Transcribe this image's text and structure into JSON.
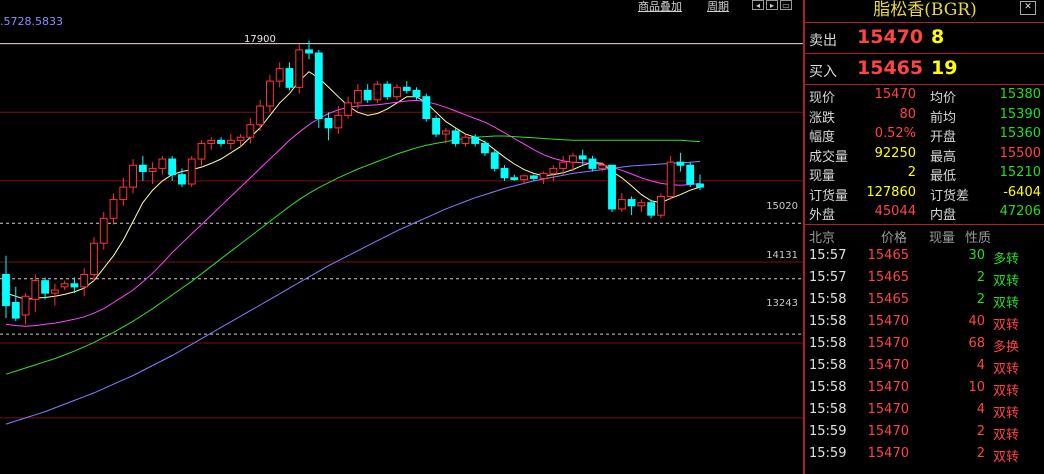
{
  "toolbar": {
    "link1": "商品叠加",
    "link2": "周期",
    "icons": [
      "prev-icon",
      "next-icon",
      "window-icon"
    ]
  },
  "chart": {
    "ma_readout": ".5728.5833",
    "high_marker": "17900",
    "price_levels": [
      {
        "label": "15020",
        "value": 15020
      },
      {
        "label": "14131",
        "value": 14131
      },
      {
        "label": "13243",
        "value": 13243
      }
    ]
  },
  "chart_data": {
    "type": "candlestick",
    "y_range": [
      11000,
      18600
    ],
    "grid_levels": [
      17900,
      16800,
      15700,
      14400,
      13100,
      11900
    ],
    "candles": [
      [
        14200,
        14500,
        13500,
        13700
      ],
      [
        13750,
        14000,
        13450,
        13500
      ],
      [
        13550,
        13900,
        13400,
        13850
      ],
      [
        13800,
        14200,
        13600,
        14100
      ],
      [
        14100,
        14150,
        13800,
        13900
      ],
      [
        13900,
        14050,
        13700,
        13950
      ],
      [
        14000,
        14100,
        13950,
        14050
      ],
      [
        14050,
        14150,
        13900,
        14000
      ],
      [
        14000,
        14300,
        13850,
        14200
      ],
      [
        14200,
        14800,
        14100,
        14700
      ],
      [
        14700,
        15200,
        14600,
        15100
      ],
      [
        15100,
        15500,
        15000,
        15400
      ],
      [
        15400,
        15750,
        15300,
        15600
      ],
      [
        15600,
        16050,
        15500,
        15950
      ],
      [
        15950,
        16100,
        15700,
        15850
      ],
      [
        15850,
        16000,
        15650,
        15900
      ],
      [
        15900,
        16100,
        15800,
        16050
      ],
      [
        16050,
        16100,
        15700,
        15800
      ],
      [
        15800,
        15900,
        15600,
        15650
      ],
      [
        15650,
        16100,
        15600,
        16050
      ],
      [
        16050,
        16350,
        15950,
        16300
      ],
      [
        16300,
        16400,
        16200,
        16350
      ],
      [
        16350,
        16400,
        16250,
        16300
      ],
      [
        16300,
        16450,
        16200,
        16350
      ],
      [
        16350,
        16450,
        16250,
        16400
      ],
      [
        16400,
        16700,
        16300,
        16600
      ],
      [
        16600,
        17000,
        16500,
        16900
      ],
      [
        16900,
        17400,
        16800,
        17300
      ],
      [
        17300,
        17600,
        17200,
        17500
      ],
      [
        17500,
        17600,
        17150,
        17200
      ],
      [
        17200,
        17900,
        17100,
        17800
      ],
      [
        17800,
        17950,
        17650,
        17750
      ],
      [
        17750,
        17800,
        16550,
        16700
      ],
      [
        16700,
        16800,
        16350,
        16550
      ],
      [
        16550,
        16900,
        16450,
        16750
      ],
      [
        16750,
        17050,
        16700,
        16950
      ],
      [
        16950,
        17250,
        16850,
        17150
      ],
      [
        17150,
        17250,
        16950,
        17000
      ],
      [
        17000,
        17300,
        16950,
        17250
      ],
      [
        17250,
        17300,
        17000,
        17050
      ],
      [
        17050,
        17250,
        17000,
        17200
      ],
      [
        17200,
        17300,
        17100,
        17150
      ],
      [
        17150,
        17200,
        17000,
        17050
      ],
      [
        17050,
        17100,
        16650,
        16700
      ],
      [
        16700,
        16750,
        16400,
        16450
      ],
      [
        16450,
        16550,
        16300,
        16500
      ],
      [
        16500,
        16550,
        16250,
        16300
      ],
      [
        16300,
        16450,
        16250,
        16400
      ],
      [
        16400,
        16450,
        16250,
        16300
      ],
      [
        16300,
        16350,
        16100,
        16150
      ],
      [
        16150,
        16200,
        15850,
        15900
      ],
      [
        15900,
        15950,
        15700,
        15750
      ],
      [
        15750,
        15800,
        15700,
        15720
      ],
      [
        15720,
        15800,
        15650,
        15780
      ],
      [
        15780,
        15800,
        15700,
        15740
      ],
      [
        15740,
        15850,
        15650,
        15820
      ],
      [
        15820,
        15950,
        15700,
        15900
      ],
      [
        15900,
        16100,
        15800,
        16000
      ],
      [
        16000,
        16150,
        15850,
        16100
      ],
      [
        16100,
        16200,
        15950,
        16050
      ],
      [
        16050,
        16100,
        15850,
        15900
      ],
      [
        15900,
        16000,
        15850,
        15950
      ],
      [
        15950,
        15900,
        15200,
        15250
      ],
      [
        15250,
        15500,
        15200,
        15400
      ],
      [
        15400,
        15450,
        15150,
        15300
      ],
      [
        15300,
        15400,
        15200,
        15350
      ],
      [
        15350,
        15400,
        15100,
        15150
      ],
      [
        15150,
        15500,
        15100,
        15450
      ],
      [
        15450,
        16100,
        15400,
        16000
      ],
      [
        16000,
        16150,
        15850,
        15950
      ],
      [
        15950,
        16000,
        15600,
        15650
      ],
      [
        15650,
        15800,
        15550,
        15600
      ]
    ],
    "ma_lines": [
      {
        "name": "ma5",
        "color": "#ffffaa",
        "values": [
          13900,
          13850,
          13800,
          13820,
          13830,
          13850,
          13880,
          13920,
          13980,
          14100,
          14300,
          14500,
          14750,
          15050,
          15350,
          15550,
          15700,
          15800,
          15850,
          15880,
          15920,
          15980,
          16050,
          16150,
          16250,
          16400,
          16550,
          16750,
          16950,
          17100,
          17300,
          17450,
          17350,
          17200,
          17050,
          16900,
          16800,
          16750,
          16780,
          16850,
          16950,
          17050,
          17050,
          16950,
          16800,
          16650,
          16550,
          16450,
          16400,
          16320,
          16200,
          16080,
          15970,
          15880,
          15820,
          15780,
          15800,
          15830,
          15880,
          15950,
          16000,
          15980,
          15850,
          15750,
          15620,
          15480,
          15380,
          15350,
          15420,
          15480,
          15550,
          15600
        ]
      },
      {
        "name": "ma10",
        "color": "#ff44ff",
        "values": [
          13400,
          13380,
          13370,
          13380,
          13400,
          13420,
          13450,
          13480,
          13520,
          13580,
          13650,
          13750,
          13850,
          13950,
          14080,
          14220,
          14380,
          14550,
          14700,
          14850,
          15000,
          15150,
          15300,
          15450,
          15600,
          15750,
          15900,
          16050,
          16200,
          16350,
          16480,
          16600,
          16700,
          16780,
          16840,
          16880,
          16900,
          16910,
          16920,
          16940,
          16960,
          16980,
          16990,
          16970,
          16930,
          16880,
          16820,
          16760,
          16700,
          16640,
          16560,
          16470,
          16380,
          16290,
          16200,
          16120,
          16060,
          16020,
          16000,
          15990,
          15980,
          15960,
          15920,
          15870,
          15810,
          15750,
          15700,
          15660,
          15640,
          15630,
          15640,
          15660
        ]
      },
      {
        "name": "ma20",
        "color": "#33dd33",
        "values": [
          12600,
          12650,
          12700,
          12750,
          12800,
          12850,
          12910,
          12970,
          13040,
          13110,
          13190,
          13270,
          13360,
          13450,
          13550,
          13650,
          13760,
          13870,
          13980,
          14090,
          14210,
          14330,
          14450,
          14570,
          14690,
          14810,
          14930,
          15050,
          15170,
          15290,
          15400,
          15500,
          15590,
          15670,
          15750,
          15820,
          15890,
          15950,
          16010,
          16070,
          16130,
          16180,
          16230,
          16270,
          16300,
          16330,
          16360,
          16380,
          16400,
          16410,
          16420,
          16420,
          16410,
          16400,
          16390,
          16380,
          16370,
          16360,
          16350,
          16350,
          16350,
          16350,
          16350,
          16350,
          16350,
          16350,
          16350,
          16350,
          16350,
          16350,
          16340,
          16330
        ]
      },
      {
        "name": "ma40",
        "color": "#8080ff",
        "values": [
          11800,
          11850,
          11900,
          11950,
          12000,
          12060,
          12120,
          12180,
          12240,
          12300,
          12370,
          12440,
          12510,
          12580,
          12660,
          12740,
          12820,
          12900,
          12990,
          13080,
          13170,
          13260,
          13350,
          13440,
          13530,
          13620,
          13710,
          13800,
          13890,
          13980,
          14070,
          14160,
          14250,
          14340,
          14420,
          14500,
          14580,
          14660,
          14740,
          14820,
          14900,
          14970,
          15040,
          15110,
          15180,
          15250,
          15310,
          15370,
          15430,
          15480,
          15530,
          15580,
          15620,
          15660,
          15700,
          15730,
          15760,
          15790,
          15820,
          15840,
          15860,
          15880,
          15900,
          15920,
          15940,
          15950,
          15960,
          15970,
          15980,
          15990,
          16000,
          16010
        ]
      }
    ]
  },
  "panel": {
    "title": "脂松香(BGR)",
    "sell": {
      "label": "卖出",
      "price": "15470",
      "volume": "8"
    },
    "buy": {
      "label": "买入",
      "price": "15465",
      "volume": "19"
    },
    "stats": [
      {
        "l": "现价",
        "lv": "15470",
        "lc": "red",
        "r": "均价",
        "rv": "15380",
        "rc": "green"
      },
      {
        "l": "涨跌",
        "lv": "80",
        "lc": "red",
        "r": "前均",
        "rv": "15390",
        "rc": "green"
      },
      {
        "l": "幅度",
        "lv": "0.52%",
        "lc": "red",
        "r": "开盘",
        "rv": "15360",
        "rc": "green"
      },
      {
        "l": "成交量",
        "lv": "92250",
        "lc": "yellow",
        "r": "最高",
        "rv": "15500",
        "rc": "red"
      },
      {
        "l": "现量",
        "lv": "2",
        "lc": "yellow",
        "r": "最低",
        "rv": "15210",
        "rc": "green"
      },
      {
        "l": "订货量",
        "lv": "127860",
        "lc": "yellow",
        "r": "订货差",
        "rv": "-6404",
        "rc": "yellow"
      },
      {
        "l": "外盘",
        "lv": "45044",
        "lc": "red",
        "r": "内盘",
        "rv": "47206",
        "rc": "green"
      }
    ],
    "tick_header": {
      "time": "北京",
      "price": "价格",
      "volume": "现量",
      "nature": "性质"
    },
    "ticks": [
      {
        "time": "15:57",
        "price": "15465",
        "volume": "30",
        "nature": "多转",
        "color": "green"
      },
      {
        "time": "15:57",
        "price": "15465",
        "volume": "2",
        "nature": "双转",
        "color": "green"
      },
      {
        "time": "15:58",
        "price": "15465",
        "volume": "2",
        "nature": "双转",
        "color": "green"
      },
      {
        "time": "15:58",
        "price": "15470",
        "volume": "40",
        "nature": "双转",
        "color": "red"
      },
      {
        "time": "15:58",
        "price": "15470",
        "volume": "68",
        "nature": "多换",
        "color": "red"
      },
      {
        "time": "15:58",
        "price": "15470",
        "volume": "4",
        "nature": "双转",
        "color": "red"
      },
      {
        "time": "15:58",
        "price": "15470",
        "volume": "10",
        "nature": "双转",
        "color": "red"
      },
      {
        "time": "15:58",
        "price": "15470",
        "volume": "4",
        "nature": "双转",
        "color": "red"
      },
      {
        "time": "15:59",
        "price": "15470",
        "volume": "2",
        "nature": "双转",
        "color": "red"
      },
      {
        "time": "15:59",
        "price": "15470",
        "volume": "2",
        "nature": "双转",
        "color": "red"
      }
    ]
  }
}
